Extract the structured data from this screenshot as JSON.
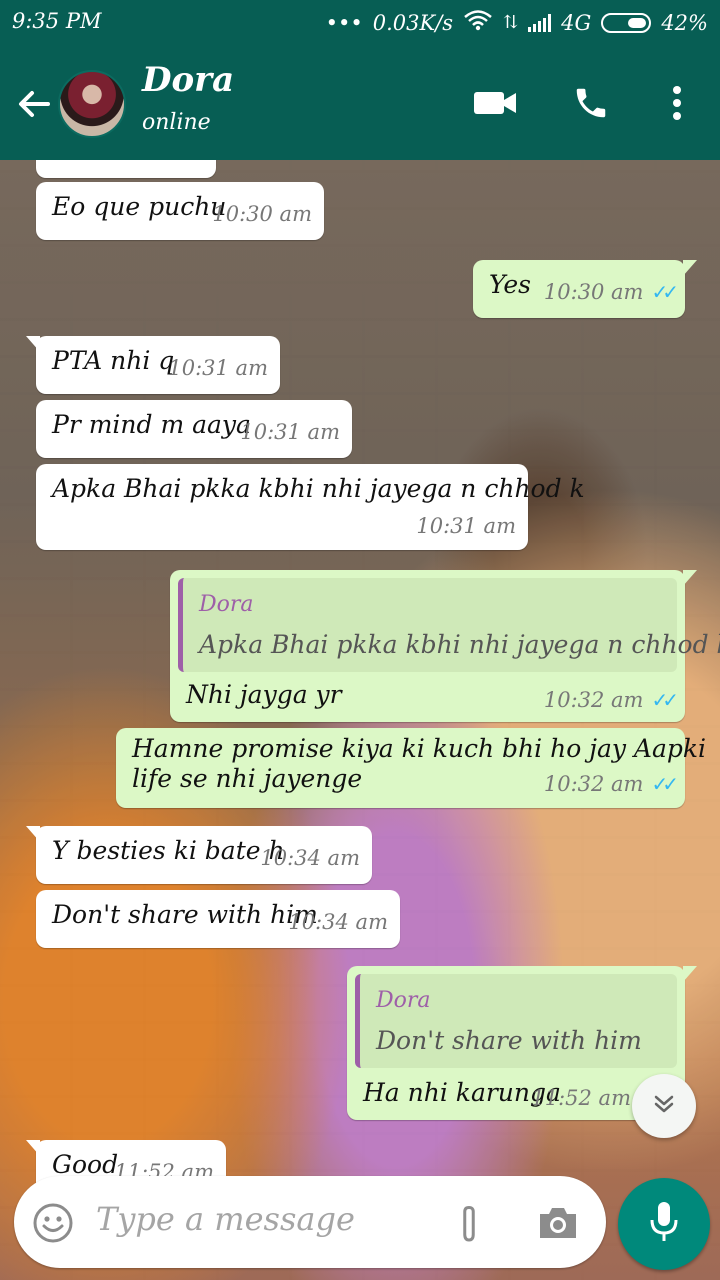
{
  "status_bar": {
    "time": "9:35 PM",
    "network_speed": "0.03K/s",
    "network_type": "4G",
    "battery": "42%"
  },
  "header": {
    "contact_name": "Dora",
    "presence": "online"
  },
  "messages": [
    {
      "dir": "in",
      "text": "Eo que puchu",
      "time": "10:30 am"
    },
    {
      "dir": "out",
      "text": "Yes",
      "time": "10:30 am"
    },
    {
      "dir": "in",
      "text": "PTA nhi q",
      "time": "10:31 am"
    },
    {
      "dir": "in",
      "text": "Pr mind m aaya",
      "time": "10:31 am"
    },
    {
      "dir": "in",
      "text": "Apka Bhai pkka kbhi nhi jayega n chhod k",
      "time": "10:31 am"
    },
    {
      "dir": "out",
      "quote_name": "Dora",
      "quote_text": "Apka Bhai pkka kbhi nhi jayega n chhod k",
      "text": "Nhi jayga yr",
      "time": "10:32 am"
    },
    {
      "dir": "out",
      "text_line1": "Hamne promise kiya ki kuch bhi ho jay Aapki",
      "text_line2": "life se nhi jayenge",
      "time": "10:32 am"
    },
    {
      "dir": "in",
      "text": "Y besties ki bate h",
      "time": "10:34 am"
    },
    {
      "dir": "in",
      "text": "Don't share with him",
      "time": "10:34 am"
    },
    {
      "dir": "out",
      "quote_name": "Dora",
      "quote_text": "Don't share with him",
      "text": "Ha nhi karunga",
      "time": "11:52 am"
    },
    {
      "dir": "in",
      "text": "Good",
      "time": "11:52 am"
    }
  ],
  "composer": {
    "placeholder": "Type a message"
  },
  "colors": {
    "header": "#075e54",
    "outgoing_bubble": "#dcf8c6",
    "incoming_bubble": "#ffffff",
    "mic_button": "#00897b",
    "read_ticks": "#34b7f1",
    "quote_accent": "#9e5fa8"
  },
  "icons": [
    "back-arrow-icon",
    "video-call-icon",
    "phone-icon",
    "more-options-icon",
    "emoji-icon",
    "attach-icon",
    "camera-icon",
    "mic-icon",
    "scroll-down-icon",
    "wifi-icon",
    "signal-icon",
    "battery-icon"
  ]
}
